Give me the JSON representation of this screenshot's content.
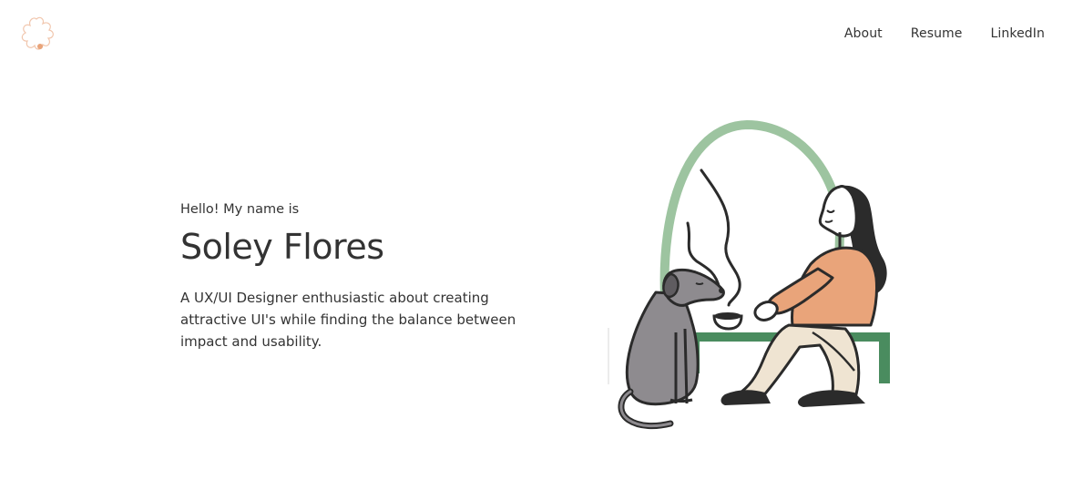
{
  "header": {
    "logo_icon": "flower-logo-icon",
    "nav": [
      {
        "label": "About"
      },
      {
        "label": "Resume"
      },
      {
        "label": "LinkedIn"
      }
    ]
  },
  "hero": {
    "greeting": "Hello! My name is",
    "name": "Soley Flores",
    "bio": "A UX/UI Designer enthusiastic about creating attractive UI's while finding the balance between impact and usability."
  },
  "illustration": {
    "icon": "woman-with-dog-illustration",
    "colors": {
      "arch": "#9dc4a0",
      "bench": "#4a8c5f",
      "shirt": "#e9a47a",
      "pants": "#efe4d2",
      "dog": "#8e8b8f",
      "outline": "#2b2b2b"
    }
  },
  "colors": {
    "text": "#333333",
    "logo": "#e9a47a",
    "background": "#ffffff"
  }
}
